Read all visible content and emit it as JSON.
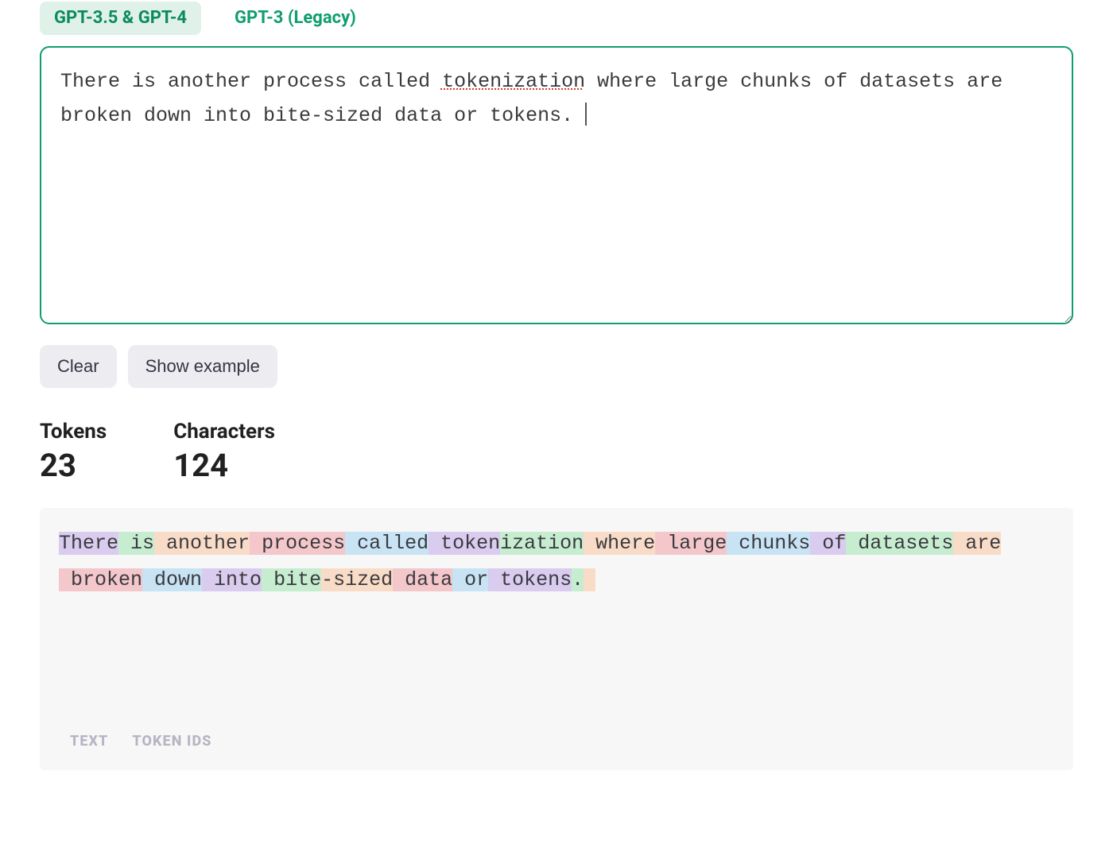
{
  "tabs": {
    "active": "GPT-3.5 & GPT-4",
    "inactive": "GPT-3 (Legacy)"
  },
  "input": {
    "text_before_spell": "There is another process called ",
    "spell_word": "tokenization",
    "text_after_spell": " where large chunks of datasets are broken down into bite-sized data or tokens. ",
    "full_text": "There is another process called tokenization where large chunks of datasets are broken down into bite-sized data or tokens. "
  },
  "buttons": {
    "clear": "Clear",
    "example": "Show example"
  },
  "stats": {
    "tokens_label": "Tokens",
    "tokens_value": "23",
    "chars_label": "Characters",
    "chars_value": "124"
  },
  "tokenized": [
    {
      "t": "There",
      "c": 0
    },
    {
      "t": " is",
      "c": 1
    },
    {
      "t": " another",
      "c": 2
    },
    {
      "t": " process",
      "c": 3
    },
    {
      "t": " called",
      "c": 4
    },
    {
      "t": " token",
      "c": 0
    },
    {
      "t": "ization",
      "c": 1
    },
    {
      "t": " where",
      "c": 2
    },
    {
      "t": " large",
      "c": 3
    },
    {
      "t": " chunks",
      "c": 4
    },
    {
      "t": " of",
      "c": 0
    },
    {
      "t": " datasets",
      "c": 1
    },
    {
      "t": " are",
      "c": 2
    },
    {
      "t": " broken",
      "c": 3
    },
    {
      "t": " down",
      "c": 4
    },
    {
      "t": " into",
      "c": 0
    },
    {
      "t": " bite",
      "c": 1
    },
    {
      "t": "-sized",
      "c": 2
    },
    {
      "t": " data",
      "c": 3
    },
    {
      "t": " or",
      "c": 4
    },
    {
      "t": " tokens",
      "c": 0
    },
    {
      "t": ".",
      "c": 1
    },
    {
      "t": " ",
      "c": 2
    }
  ],
  "panel_tabs": {
    "text": "TEXT",
    "token_ids": "TOKEN IDS"
  }
}
